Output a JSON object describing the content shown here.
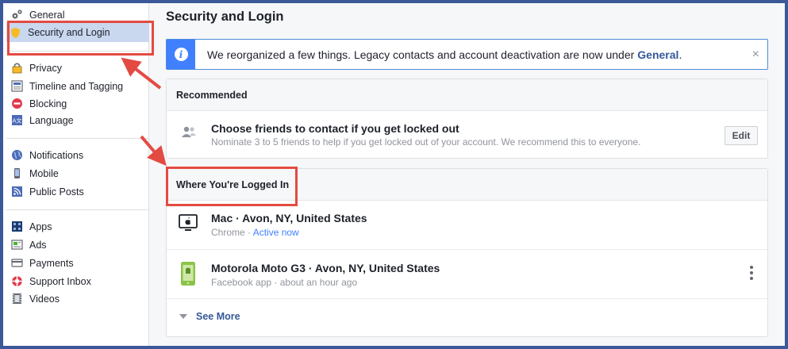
{
  "sidebar": {
    "items": [
      {
        "label": "General",
        "icon": "gears-icon"
      },
      {
        "label": "Security and Login",
        "icon": "shield-icon"
      },
      {
        "label": "Privacy",
        "icon": "lock-icon"
      },
      {
        "label": "Timeline and Tagging",
        "icon": "timeline-icon"
      },
      {
        "label": "Blocking",
        "icon": "block-icon"
      },
      {
        "label": "Language",
        "icon": "language-icon"
      },
      {
        "label": "Notifications",
        "icon": "globe-icon"
      },
      {
        "label": "Mobile",
        "icon": "mobile-icon"
      },
      {
        "label": "Public Posts",
        "icon": "rss-icon"
      },
      {
        "label": "Apps",
        "icon": "apps-icon"
      },
      {
        "label": "Ads",
        "icon": "ads-icon"
      },
      {
        "label": "Payments",
        "icon": "card-icon"
      },
      {
        "label": "Support Inbox",
        "icon": "lifebuoy-icon"
      },
      {
        "label": "Videos",
        "icon": "film-icon"
      }
    ]
  },
  "main": {
    "title": "Security and Login",
    "notice": {
      "text": "We reorganized a few things. Legacy contacts and account deactivation are now under",
      "link": "General",
      "suffix": ".",
      "close": "×"
    },
    "recommended": {
      "header": "Recommended",
      "title": "Choose friends to contact if you get locked out",
      "subtitle": "Nominate 3 to 5 friends to help if you get locked out of your account. We recommend this to everyone.",
      "edit_label": "Edit"
    },
    "logged_in": {
      "header": "Where You're Logged In",
      "sessions": [
        {
          "device": "Mac · Avon, NY, United States",
          "app": "Chrome · ",
          "status": "Active now",
          "icon": "desktop-icon"
        },
        {
          "device": "Motorola Moto G3 · Avon, NY, United States",
          "app": "Facebook app · about an hour ago",
          "status": "",
          "icon": "phone-icon"
        }
      ],
      "see_more": "See More"
    }
  },
  "colors": {
    "frame": "#3b5998",
    "accent": "#4080ff",
    "annotation": "#e34b42",
    "active_item": "#c9d7ef"
  }
}
